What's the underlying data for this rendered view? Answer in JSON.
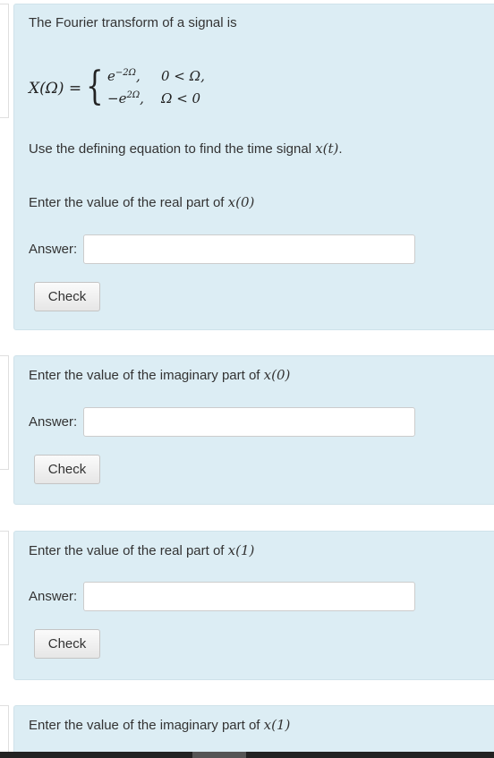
{
  "q1": {
    "intro": "The Fourier transform of a signal is",
    "equation": {
      "lhs": "X(Ω) =",
      "row1_expr_base": "e",
      "row1_expr_exp": "−2Ω",
      "row1_expr_suffix": ",",
      "row1_cond": "0 < Ω,",
      "row2_expr_base": "−e",
      "row2_expr_exp": "2Ω",
      "row2_expr_suffix": ",",
      "row2_cond": "Ω < 0"
    },
    "instruction_prefix": "Use the defining equation to find the time signal ",
    "instruction_math": "x(t)",
    "instruction_suffix": ".",
    "prompt_prefix": "Enter the value of the real part of ",
    "prompt_math": "x(0)",
    "answer_label": "Answer:",
    "answer_value": "",
    "check_label": "Check"
  },
  "q2": {
    "prompt_prefix": "Enter the value of the imaginary part of ",
    "prompt_math": "x(0)",
    "answer_label": "Answer:",
    "answer_value": "",
    "check_label": "Check"
  },
  "q3": {
    "prompt_prefix": "Enter the value of the real part of ",
    "prompt_math": "x(1)",
    "answer_label": "Answer:",
    "answer_value": "",
    "check_label": "Check"
  },
  "q4": {
    "prompt_prefix": "Enter the value of the imaginary part of ",
    "prompt_math": "x(1)"
  },
  "colors": {
    "box_background": "#dcedf4",
    "box_border": "#cfe2ea",
    "text": "#333333"
  }
}
